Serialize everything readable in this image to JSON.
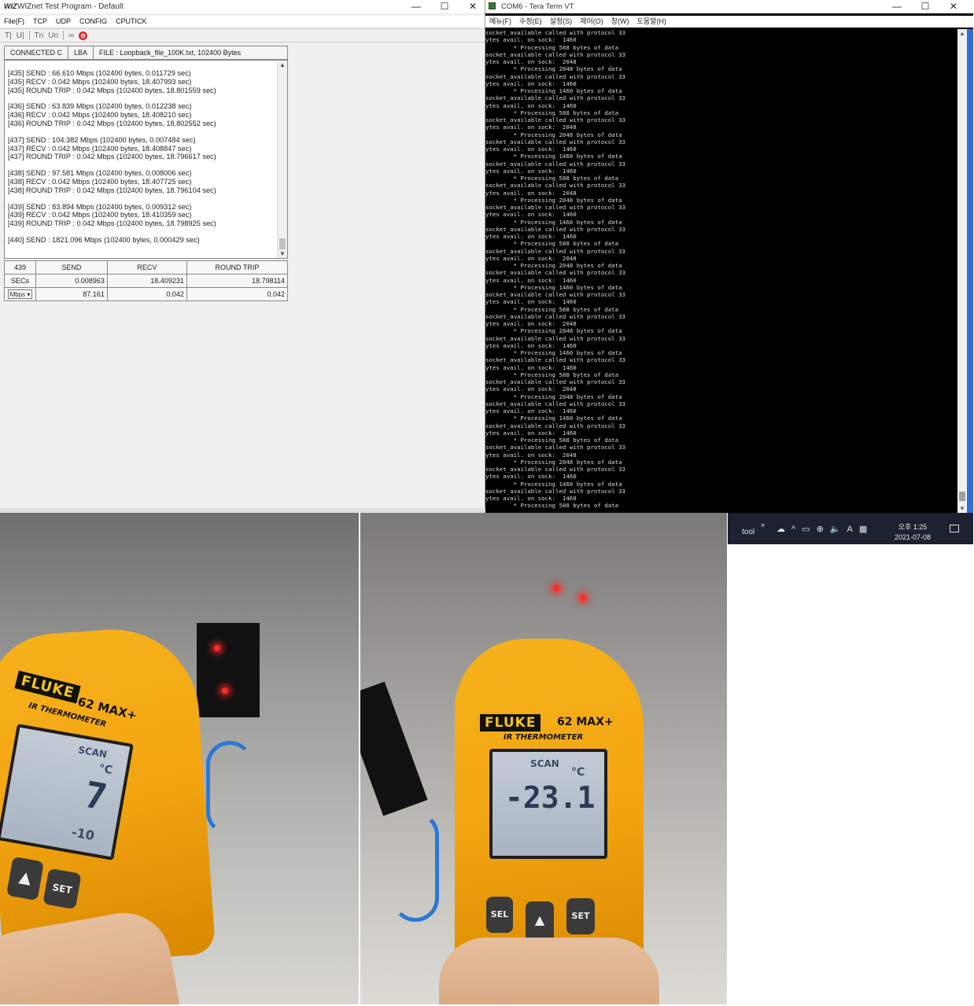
{
  "wiznet": {
    "title": "WIZnet Test Program - Default",
    "app_icon": "WIZ",
    "menu": [
      "File(F)",
      "TCP",
      "UDP",
      "CONFIG",
      "CPUTICK"
    ],
    "toolbar": [
      "T|",
      "U|",
      "Tn",
      "Un",
      "∞"
    ],
    "status": {
      "connection": "CONNECTED C",
      "mode": "LBA",
      "file": "FILE : Loopback_file_100K.txt,  102400 Bytes"
    },
    "log": [
      "[435] SEND : 66.610 Mbps (102400 bytes, 0.011729 sec)",
      "[435] RECV : 0.042 Mbps (102400 bytes, 18.407993 sec)",
      "[435] ROUND TRIP : 0.042 Mbps (102400 bytes, 18.801559 sec)",
      "",
      "[436] SEND : 63.839 Mbps (102400 bytes, 0.012238 sec)",
      "[436] RECV : 0.042 Mbps (102400 bytes, 18.408210 sec)",
      "[436] ROUND TRIP : 0.042 Mbps (102400 bytes, 18.802552 sec)",
      "",
      "[437] SEND : 104.382 Mbps (102400 bytes, 0.007484 sec)",
      "[437] RECV : 0.042 Mbps (102400 bytes, 18.408847 sec)",
      "[437] ROUND TRIP : 0.042 Mbps (102400 bytes, 18.796617 sec)",
      "",
      "[438] SEND : 97.581 Mbps (102400 bytes, 0.008006 sec)",
      "[438] RECV : 0.042 Mbps (102400 bytes, 18.407725 sec)",
      "[438] ROUND TRIP : 0.042 Mbps (102400 bytes, 18.796104 sec)",
      "",
      "[439] SEND : 83.894 Mbps (102400 bytes, 0.009312 sec)",
      "[439] RECV : 0.042 Mbps (102400 bytes, 18.410359 sec)",
      "[439] ROUND TRIP : 0.042 Mbps (102400 bytes, 18.798925 sec)",
      "",
      "[440] SEND : 1821.096 Mbps (102400 bytes, 0.000429 sec)"
    ],
    "stats": {
      "count": "439",
      "headers": [
        "SEND",
        "RECV",
        "ROUND TRIP"
      ],
      "secs_label": "SECs",
      "secs": [
        "0.008963",
        "18.409231",
        "18.798114"
      ],
      "unit": "Mbps",
      "rates": [
        "87.161",
        "0.042",
        "0.042"
      ]
    }
  },
  "tera": {
    "title": "COM6 - Tera Term VT",
    "menu": [
      "메뉴(F)",
      "수정(E)",
      "설정(S)",
      "제어(O)",
      "창(W)",
      "도움말(H)"
    ],
    "lines": [
      "socket_available called with protocol 33",
      "ytes avail. on sock:  1460",
      "        * Processing 588 bytes of data",
      "socket_available called with protocol 33",
      "ytes avail. on sock:  2048",
      "        * Processing 2048 bytes of data",
      "socket_available called with protocol 33",
      "ytes avail. on sock:  1460",
      "        * Processing 1460 bytes of data",
      "socket_available called with protocol 33",
      "ytes avail. on sock:  1460",
      "        * Processing 588 bytes of data",
      "socket_available called with protocol 33",
      "ytes avail. on sock:  2048",
      "        * Processing 2048 bytes of data",
      "socket_available called with protocol 33",
      "ytes avail. on sock:  1460",
      "        * Processing 1460 bytes of data",
      "socket_available called with protocol 33",
      "ytes avail. on sock:  1460",
      "        * Processing 588 bytes of data",
      "socket_available called with protocol 33",
      "ytes avail. on sock:  2048",
      "        * Processing 2048 bytes of data",
      "socket_available called with protocol 33",
      "ytes avail. on sock:  1460",
      "        * Processing 1460 bytes of data",
      "socket_available called with protocol 33",
      "ytes avail. on sock:  1460",
      "        * Processing 588 bytes of data",
      "socket_available called with protocol 33",
      "ytes avail. on sock:  2048",
      "        * Processing 2048 bytes of data",
      "socket_available called with protocol 33",
      "ytes avail. on sock:  1460",
      "        * Processing 1460 bytes of data",
      "socket_available called with protocol 33",
      "ytes avail. on sock:  1460",
      "        * Processing 588 bytes of data",
      "socket_available called with protocol 33",
      "ytes avail. on sock:  2048",
      "        * Processing 2048 bytes of data",
      "socket_available called with protocol 33",
      "ytes avail. on sock:  1460",
      "        * Processing 1460 bytes of data",
      "socket_available called with protocol 33",
      "ytes avail. on sock:  1460",
      "        * Processing 588 bytes of data",
      "socket_available called with protocol 33",
      "ytes avail. on sock:  2048",
      "        * Processing 2048 bytes of data",
      "socket_available called with protocol 33",
      "ytes avail. on sock:  1460",
      "        * Processing 1460 bytes of data",
      "socket_available called with protocol 33",
      "ytes avail. on sock:  1460",
      "        * Processing 588 bytes of data",
      "socket_available called with protocol 33",
      "ytes avail. on sock:  2048",
      "        * Processing 2048 bytes of data",
      "socket_available called with protocol 33",
      "ytes avail. on sock:  1460",
      "        * Processing 1460 bytes of data",
      "socket_available called with protocol 33",
      "ytes avail. on sock:  1460",
      "        * Processing 588 bytes of data"
    ]
  },
  "taskbar": {
    "tool_label": "tool",
    "chevron": "»",
    "ime": "A",
    "time": "오후 1:25",
    "date": "2021-07-08"
  },
  "photos": {
    "brand": "FLUKE",
    "model": "62 MAX+",
    "subtitle": "IR THERMOMETER",
    "left": {
      "mode": "SCAN",
      "unit": "°C",
      "reading": "7",
      "lower": "-10"
    },
    "right": {
      "mode": "SCAN",
      "unit": "°C",
      "reading": "-23.1"
    },
    "btn_sel": "SEL",
    "btn_set": "SET"
  }
}
